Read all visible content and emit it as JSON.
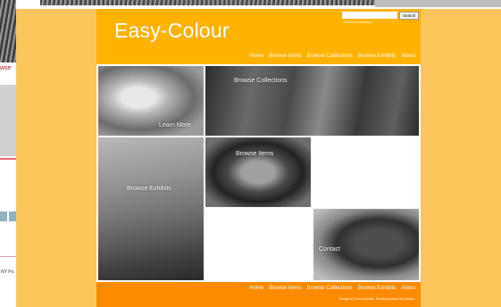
{
  "left_bleed": {
    "red_text": "wse",
    "footer_text": "NY Po"
  },
  "site": {
    "title": "Easy-Colour"
  },
  "search": {
    "button_label": "Search",
    "advanced_link": "Advanced Search"
  },
  "nav": {
    "items": [
      "Home",
      "Browse Items",
      "Browse Collections",
      "Browse Exhibits",
      "About"
    ]
  },
  "tiles": {
    "learn_more": "Learn More",
    "browse_collections": "Browse Collections",
    "browse_exhibits": "Browse Exhibits",
    "browse_items": "Browse Items",
    "contact": "Contact"
  },
  "footer": {
    "nav": [
      "Home",
      "Browse Items",
      "Browse Collections",
      "Browse Exhibits",
      "About"
    ],
    "credit": "Design by Omni Guenthe. Proudly powered by Omeka."
  },
  "colors": {
    "header": "#ffb200",
    "footer": "#ff8a00",
    "sides": "#fdc65c"
  }
}
